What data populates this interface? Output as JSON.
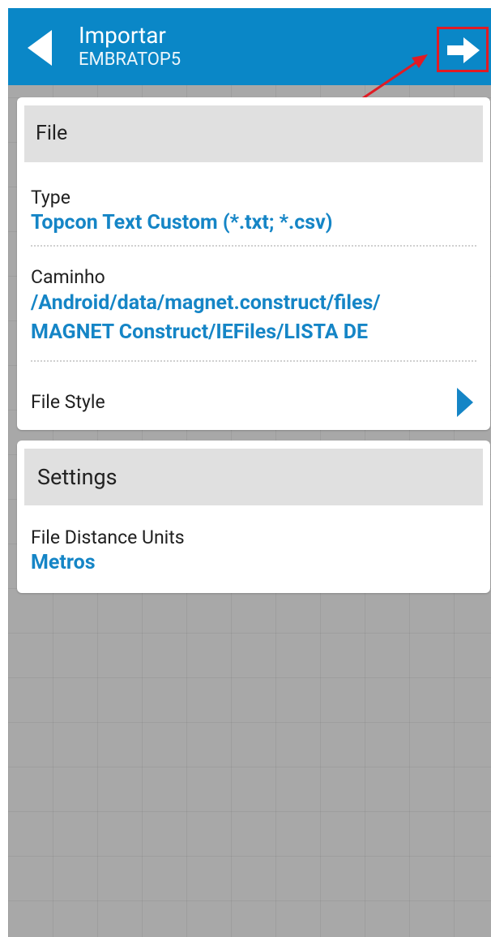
{
  "app_bar": {
    "title": "Importar",
    "subtitle": "EMBRATOP5",
    "back_icon": "caret-left-icon",
    "next_icon": "arrow-right-icon",
    "color": "#0a87c7"
  },
  "file_section": {
    "header": "File",
    "type": {
      "label": "Type",
      "value": "Topcon Text Custom (*.txt; *.csv)"
    },
    "path": {
      "label": "Caminho",
      "value_line1": "/Android/data/magnet.construct/files/",
      "value_line2": "MAGNET Construct/IEFiles/LISTA DE"
    },
    "file_style": {
      "label": "File Style",
      "icon": "chevron-right-icon"
    }
  },
  "settings_section": {
    "header": "Settings",
    "distance_units": {
      "label": "File Distance Units",
      "value": "Metros"
    }
  },
  "colors": {
    "accent": "#1585c6",
    "annotation": "#e01b24",
    "background": "#a8a8a8"
  }
}
